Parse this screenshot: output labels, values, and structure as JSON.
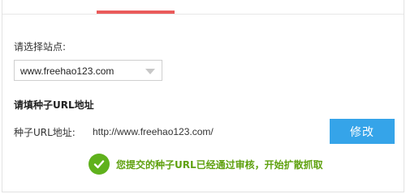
{
  "form": {
    "site_label": "请选择站点:",
    "site_select": {
      "value": "www.freehao123.com"
    },
    "section_title": "请填种子URL地址",
    "url_label": "种子URL地址:",
    "url_value": "http://www.freehao123.com/",
    "modify_button": "修改"
  },
  "status": {
    "message": "您提交的种子URL已经通过审核，开始扩散抓取",
    "icon": "check-circle-icon"
  },
  "colors": {
    "tab_accent": "#ea5b5b",
    "button": "#35a4e9",
    "success": "#5fa10f"
  }
}
